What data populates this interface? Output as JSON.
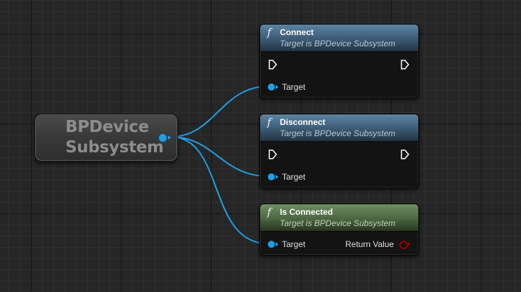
{
  "graph": {
    "variable_node": {
      "title": "BPDevice Subsystem",
      "pin_color": "#1f9fe8"
    },
    "function_nodes": [
      {
        "id": "connect",
        "icon": "function-icon",
        "icon_glyph": "f",
        "title": "Connect",
        "subtitle": "Target is BPDevice Subsystem",
        "header_color": "#3b5a73",
        "input_pin_label": "Target"
      },
      {
        "id": "disconnect",
        "icon": "function-icon",
        "icon_glyph": "f",
        "title": "Disconnect",
        "subtitle": "Target is BPDevice Subsystem",
        "header_color": "#3b5a73",
        "input_pin_label": "Target"
      },
      {
        "id": "is-connected",
        "icon": "function-icon",
        "icon_glyph": "f",
        "title": "Is Connected",
        "subtitle": "Target is BPDevice Subsystem",
        "header_color": "#4b6541",
        "input_pin_label": "Target",
        "output_pin_label": "Return Value",
        "output_pin_color": "#9a0000"
      }
    ],
    "wire_color": "#1f9fe8",
    "background_color": "#262626"
  }
}
